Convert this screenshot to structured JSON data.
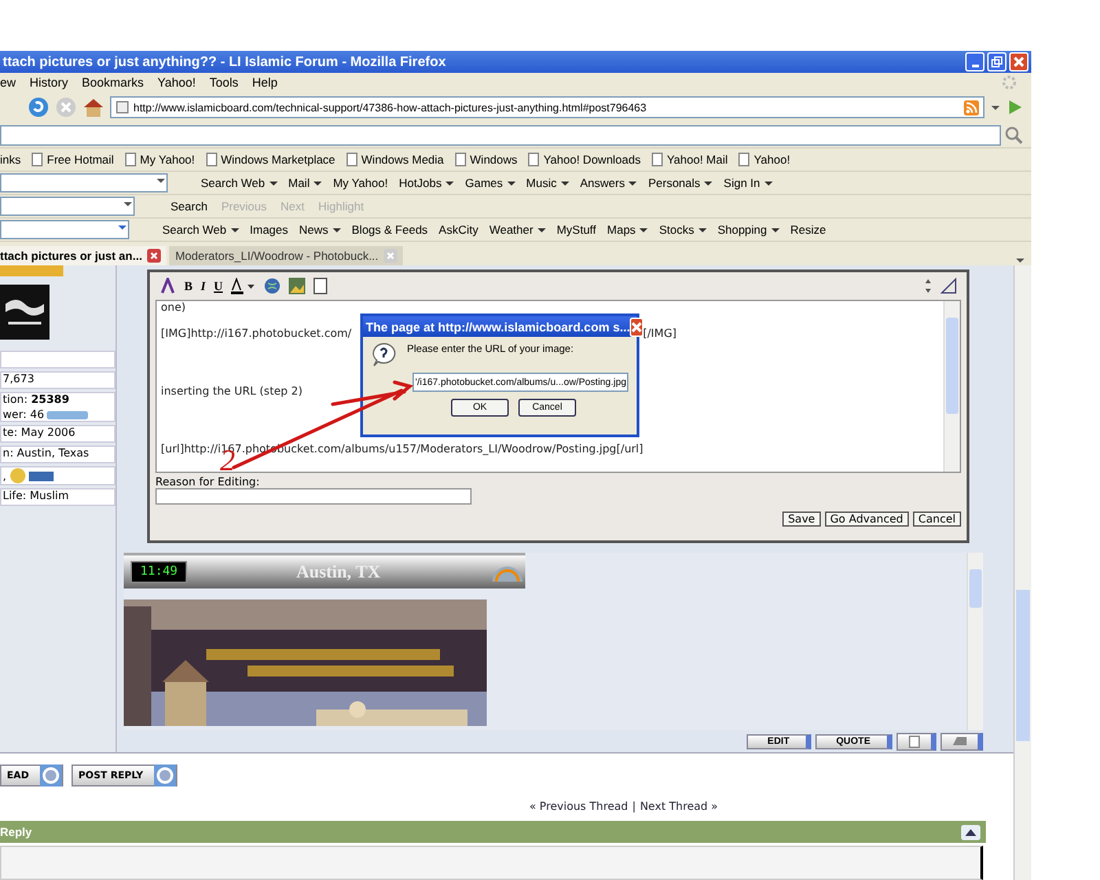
{
  "window": {
    "title": "ttach pictures or just anything?? - LI Islamic Forum - Mozilla Firefox"
  },
  "menu": [
    "ew",
    "History",
    "Bookmarks",
    "Yahoo!",
    "Tools",
    "Help"
  ],
  "address": {
    "value": "http://www.islamicboard.com/technical-support/47386-how-attach-pictures-just-anything.html#post796463"
  },
  "bookmarks": [
    "inks",
    "Free Hotmail",
    "My Yahoo!",
    "Windows Marketplace",
    "Windows Media",
    "Windows",
    "Yahoo! Downloads",
    "Yahoo! Mail",
    "Yahoo!"
  ],
  "yahoo_toolbar": [
    {
      "label": "Search Web",
      "dropdown": true
    },
    {
      "label": "Mail",
      "dropdown": true
    },
    {
      "label": "My Yahoo!",
      "dropdown": false
    },
    {
      "label": "HotJobs",
      "dropdown": true
    },
    {
      "label": "Games",
      "dropdown": true
    },
    {
      "label": "Music",
      "dropdown": true
    },
    {
      "label": "Answers",
      "dropdown": true
    },
    {
      "label": "Personals",
      "dropdown": true
    },
    {
      "label": "Sign In",
      "dropdown": true
    }
  ],
  "find_bar": [
    {
      "label": "Search",
      "disabled": false
    },
    {
      "label": "Previous",
      "disabled": true
    },
    {
      "label": "Next",
      "disabled": true
    },
    {
      "label": "Highlight",
      "disabled": true
    }
  ],
  "search_toolbar": [
    {
      "label": "Search Web",
      "dropdown": true
    },
    {
      "label": "Images",
      "dropdown": false
    },
    {
      "label": "News",
      "dropdown": true
    },
    {
      "label": "Blogs & Feeds",
      "dropdown": false
    },
    {
      "label": "AskCity",
      "dropdown": false
    },
    {
      "label": "Weather",
      "dropdown": true
    },
    {
      "label": "MyStuff",
      "dropdown": false
    },
    {
      "label": "Maps",
      "dropdown": true
    },
    {
      "label": "Stocks",
      "dropdown": true
    },
    {
      "label": "Shopping",
      "dropdown": true
    },
    {
      "label": "Resize",
      "dropdown": false
    }
  ],
  "tabs": [
    {
      "label": "ttach pictures or just an...",
      "selected": true
    },
    {
      "label": "Moderators_LI/Woodrow - Photobuck...",
      "selected": false
    }
  ],
  "profile": [
    {
      "kind": "text",
      "text": "7,673"
    },
    {
      "kind": "reputation",
      "lines": [
        "tion: **25389**",
        "wer: 46"
      ]
    },
    {
      "kind": "text",
      "text": "te: May 2006"
    },
    {
      "kind": "text",
      "text": "n: Austin, Texas"
    },
    {
      "kind": "badge",
      "text": ","
    },
    {
      "kind": "text",
      "text": "Life: Muslim"
    }
  ],
  "editor": {
    "lines": [
      {
        "left": "one)"
      },
      {
        "left": "[IMG]http://i167.photobucket.com/",
        "right": "[/IMG]"
      },
      {
        "left": "inserting the URL (step 2)"
      },
      {
        "left": "[url]http://i167.photobucket.com/albums/u157/Moderators_LI/Woodrow/Posting.jpg[/url]"
      }
    ],
    "format_buttons": [
      "B",
      "I",
      "U"
    ],
    "reason_label": "Reason for Editing:",
    "buttons": [
      "Save",
      "Go Advanced",
      "Cancel"
    ]
  },
  "dialog": {
    "title": "The page at http://www.islamicboard.com s...",
    "message": "Please enter the URL of your image:",
    "value": "'/i167.photobucket.com/albums/u...ow/Posting.jpg",
    "buttons": [
      "OK",
      "Cancel"
    ]
  },
  "annotation": {
    "label": "2"
  },
  "signature": {
    "clock": "11:49",
    "city": "Austin, TX"
  },
  "post_buttons": [
    "EDIT",
    "QUOTE"
  ],
  "thread_buttons": [
    "EAD",
    "POST REPLY"
  ],
  "thread_nav": {
    "previous": "« Previous Thread",
    "separator": "|",
    "next": "Next Thread »"
  },
  "reply_bar": {
    "title": "Reply"
  }
}
